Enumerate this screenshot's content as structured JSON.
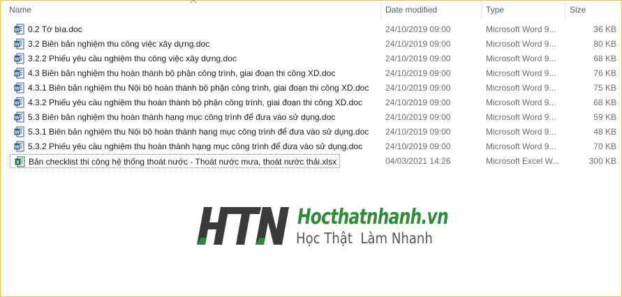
{
  "columns": {
    "name": "Name",
    "date": "Date modified",
    "type": "Type",
    "size": "Size"
  },
  "files": [
    {
      "name": "0.2 Tờ bìa.doc",
      "date": "24/10/2019 09:00",
      "type": "Microsoft Word 9...",
      "size": "36 KB",
      "icon": "word-doc-icon"
    },
    {
      "name": "3.2 Biên bản nghiệm thu công việc xây dựng.doc",
      "date": "24/10/2019 09:00",
      "type": "Microsoft Word 9...",
      "size": "80 KB",
      "icon": "word-doc-icon"
    },
    {
      "name": "3.2.2 Phiếu yêu cầu nghiệm thu công việc xây dựng.doc",
      "date": "24/10/2019 09:00",
      "type": "Microsoft Word 9...",
      "size": "68 KB",
      "icon": "word-doc-icon"
    },
    {
      "name": "4.3 Biên bản nghiệm thu hoàn thành bộ phận công trình, giai đoạn thi công XD.doc",
      "date": "24/10/2019 09:00",
      "type": "Microsoft Word 9...",
      "size": "76 KB",
      "icon": "word-doc-icon"
    },
    {
      "name": "4.3.1 Biên bản nghiệm thu Nội bộ hoàn thành bộ phận công trình, giai đoạn thi công XD.doc",
      "date": "24/10/2019 09:00",
      "type": "Microsoft Word 9...",
      "size": "75 KB",
      "icon": "word-doc-icon"
    },
    {
      "name": "4.3.2 Phiếu yêu cầu nghiệm thu hoàn thành bộ phận công trình, giai đoạn thi công XD.doc",
      "date": "24/10/2019 09:00",
      "type": "Microsoft Word 9...",
      "size": "68 KB",
      "icon": "word-doc-icon"
    },
    {
      "name": "5.3 Biên bản nghiệm thu hoàn thành hạng mục công trình để đưa vào sử dụng.doc",
      "date": "24/10/2019 09:00",
      "type": "Microsoft Word 9...",
      "size": "59 KB",
      "icon": "word-doc-icon"
    },
    {
      "name": "5.3.1 Biên bản nghiệm thu Nội bộ hoàn thành hạng mục công trình để đưa vào sử dụng.doc",
      "date": "24/10/2019 09:00",
      "type": "Microsoft Word 9...",
      "size": "48 KB",
      "icon": "word-doc-icon"
    },
    {
      "name": "5.3.2 Phiếu yêu cầu nghiệm thu hoàn thành hạng mục công trình để đưa vào sử dụng.doc",
      "date": "24/10/2019 09:00",
      "type": "Microsoft Word 9...",
      "size": "70 KB",
      "icon": "word-doc-icon"
    },
    {
      "name": "Bản checklist thi công hệ thống thoát nước - Thoát nước mưa, thoát nước thải.xlsx",
      "date": "04/03/2021 14:26",
      "type": "Microsoft Excel W...",
      "size": "300 KB",
      "icon": "excel-sheet-icon"
    }
  ],
  "brand": {
    "logo_text": "HTN",
    "name": "Hocthatnhanh.vn",
    "slogan": "Học Thật  Làm Nhanh",
    "green": "#2f8a3a",
    "dark": "#3a3a3a"
  },
  "colors": {
    "word_blue": "#2b579a",
    "excel_green": "#1e7145",
    "header_text": "#4c607a",
    "frame_border": "#f0c44a"
  }
}
